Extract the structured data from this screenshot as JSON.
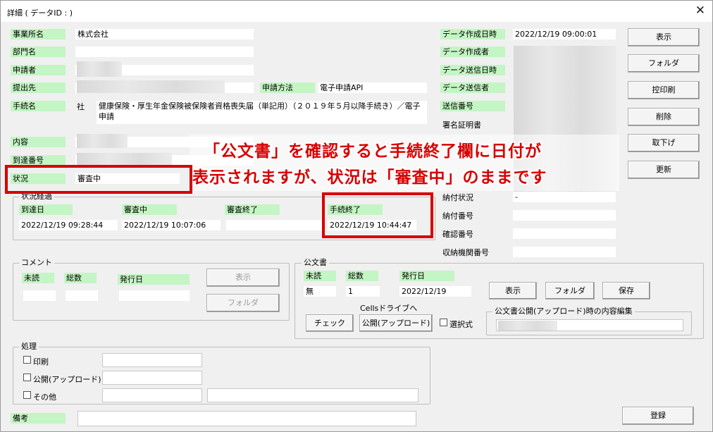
{
  "window": {
    "title": "詳細 ( データID :                                        )",
    "close_glyph": "✕"
  },
  "left": {
    "jigyousho_label": "事業所名",
    "jigyousho_value": "株式会社",
    "bumon_label": "部門名",
    "shinseisha_label": "申請者",
    "teishutsusaki_label": "提出先",
    "shinsei_houhou_label": "申請方法",
    "shinsei_houhou_value": "電子申請API",
    "tetsuzuki_label": "手続名",
    "tetsuzuki_prefix": "社",
    "tetsuzuki_value": "健康保険・厚生年金保険被保険者資格喪失届（単記用）（２０１９年５月以降手続き）／電子申請",
    "naiyou_label": "内容",
    "toutatsu_bangou_label": "到達番号",
    "joukyou_label": "状況",
    "joukyou_value": "審査中"
  },
  "progress": {
    "title": "状況経過",
    "toutatsu_label": "到達日",
    "toutatsu_value": "2022/12/19 09:28:44",
    "shinsachu_label": "審査中",
    "shinsachu_value": "2022/12/19 10:07:06",
    "shinsa_shuryo_label": "審査終了",
    "tetsuzuki_shuryo_label": "手続終了",
    "tetsuzuki_shuryo_value": "2022/12/19 10:44:47"
  },
  "right": {
    "data_created_label": "データ作成日時",
    "data_created_value": "2022/12/19 09:00:01",
    "data_creator_label": "データ作成者",
    "data_sent_label": "データ送信日時",
    "data_sender_label": "データ送信者",
    "send_number_label": "送信番号",
    "signature_label": "署名証明書",
    "nofu_joukyou_label": "納付状況",
    "nofu_joukyou_value": "-",
    "nofu_bangou_label": "納付番号",
    "kakunin_bangou_label": "確認番号",
    "shuunou_label": "収納機関番号"
  },
  "side_buttons": [
    "表示",
    "フォルダ",
    "控印刷",
    "削除",
    "取下げ",
    "更新"
  ],
  "comment": {
    "title": "コメント",
    "midoku_label": "未読",
    "sousuu_label": "総数",
    "hakkoubi_label": "発行日",
    "show_button": "表示",
    "folder_button": "フォルダ"
  },
  "kobunsho": {
    "title": "公文書",
    "midoku_label": "未読",
    "sousuu_label": "総数",
    "hakkoubi_label": "発行日",
    "midoku_value": "無",
    "sousuu_value": "1",
    "hakkoubi_value": "2022/12/19",
    "show_button": "表示",
    "folder_button": "フォルダ",
    "save_button": "保存",
    "cells_label": "Cellsドライブへ",
    "check_button": "チェック",
    "publish_button": "公開(アップロード)",
    "select_label": "選択式",
    "edit_group_title": "公文書公開(アップロード)時の内容編集"
  },
  "shori": {
    "title": "処理",
    "print_label": "印刷",
    "publish_label": "公開(アップロード)",
    "other_label": "その他"
  },
  "bikou_label": "備考",
  "register_button": "登録",
  "annotation": {
    "line1": "「公文書」を確認すると手続終了欄に日付が",
    "line2": "表示されますが、状況は「審査中」のままです"
  },
  "colors": {
    "label_bg": "#c4f5c4",
    "window_bg": "#f0f0f0",
    "highlight": "#d80000"
  }
}
